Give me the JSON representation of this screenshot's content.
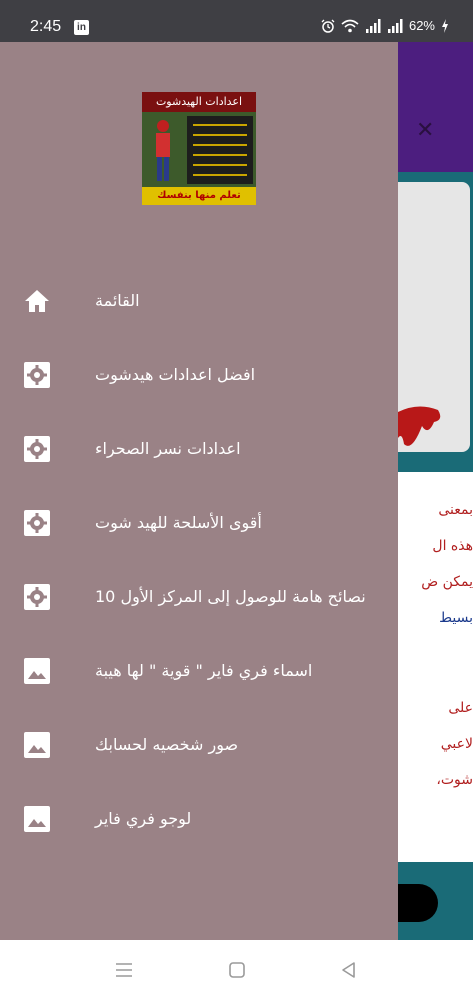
{
  "status_bar": {
    "time": "2:45",
    "app_icon": "linkedin-icon",
    "battery": "62%",
    "icons": [
      "alarm-icon",
      "wifi-icon",
      "signal-icon",
      "signal-icon",
      "battery-icon"
    ]
  },
  "drawer": {
    "header_image": {
      "banner_text": "اعدادات الهيدشوت",
      "footer_text": "تعلم منها بنفسك"
    },
    "items": [
      {
        "label": "القائمة",
        "icon": "home-icon"
      },
      {
        "label": "افضل اعدادات هيدشوت",
        "icon": "gear-icon"
      },
      {
        "label": "اعدادات نسر الصحراء",
        "icon": "gear-icon"
      },
      {
        "label": "أقوى الأسلحة للهيد شوت",
        "icon": "gear-icon"
      },
      {
        "label": "نصائح هامة للوصول إلى المركز الأول 10",
        "icon": "gear-icon"
      },
      {
        "label": "اسماء فري فاير \" قوية \" لها هيبة",
        "icon": "image-icon"
      },
      {
        "label": "صور شخصيه لحسابك",
        "icon": "image-icon"
      },
      {
        "label": "لوجو فري فاير",
        "icon": "image-icon"
      }
    ]
  },
  "background": {
    "close_icon": "close-icon",
    "lines": [
      {
        "text": "بمعنى",
        "color": "#b11f1f"
      },
      {
        "text": "هذه ال",
        "color": "#b11f1f"
      },
      {
        "text": "يمكن ض",
        "color": "#b11f1f"
      },
      {
        "text": "بسيط",
        "color": "#1b3a8c"
      },
      {
        "text": "على",
        "color": "#b11f1f"
      },
      {
        "text": "لاعبي",
        "color": "#b11f1f"
      },
      {
        "text": "شوت،",
        "color": "#b11f1f"
      }
    ]
  },
  "nav_bar": {
    "buttons": [
      "menu-icon",
      "home-square-icon",
      "back-triangle-icon"
    ]
  },
  "colors": {
    "drawer": "#9a8286",
    "status_bar": "#3f3f44",
    "bg_header": "#4c1e7f",
    "bg_teal": "#1a6b77"
  }
}
